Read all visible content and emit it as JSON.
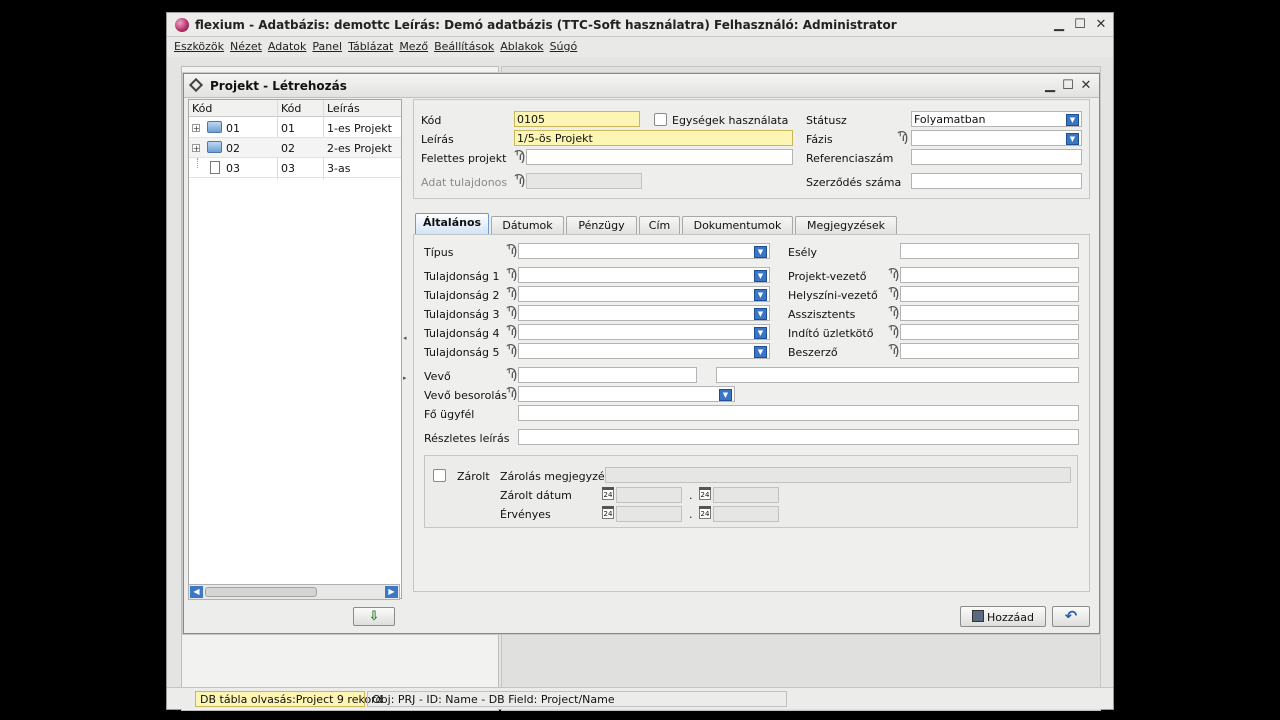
{
  "app": {
    "title": "flexium - Adatbázis: demottc  Leírás: Demó adatbázis (TTC-Soft használatra)  Felhasználó: Administrator",
    "window_buttons": {
      "minimize": "▁",
      "maximize": "☐",
      "close": "✕"
    }
  },
  "menu": [
    "Eszközök",
    "Nézet",
    "Adatok",
    "Panel",
    "Táblázat",
    "Mező",
    "Beállítások",
    "Ablakok",
    "Súgó"
  ],
  "dialog": {
    "title": "Projekt - Létrehozás",
    "window_buttons": {
      "minimize": "▁",
      "maximize": "☐",
      "close": "✕"
    }
  },
  "tree": {
    "columns": [
      "Kód",
      "Kód",
      "Leírás"
    ],
    "rows": [
      {
        "expander": "+",
        "icon": "folder-icon",
        "code1": "01",
        "code2": "01",
        "desc": "1-es Projekt"
      },
      {
        "expander": "+",
        "icon": "folder-icon",
        "code1": "02",
        "code2": "02",
        "desc": "2-es Projekt"
      },
      {
        "expander": "",
        "icon": "document-icon",
        "code1": "03",
        "code2": "03",
        "desc": "3-as"
      }
    ],
    "scroll_left": "◀",
    "scroll_right": "▶"
  },
  "header_form": {
    "kod_label": "Kód",
    "kod_value": "0105",
    "leiras_label": "Leírás",
    "leiras_value": "1/5-ös Projekt",
    "felettes_label": "Felettes projekt",
    "felettes_value": "",
    "adat_tulajdonos_label": "Adat tulajdonos",
    "egysegek_label": "Egységek használata",
    "statusz_label": "Státusz",
    "statusz_value": "Folyamatban",
    "fazis_label": "Fázis",
    "fazis_value": "",
    "referenciaszam_label": "Referenciaszám",
    "szerzodes_label": "Szerződés száma"
  },
  "tabs": [
    "Általános",
    "Dátumok",
    "Pénzügy",
    "Cím",
    "Dokumentumok",
    "Megjegyzések"
  ],
  "general_tab": {
    "tipus_label": "Típus",
    "tulajdonsag_labels": [
      "Tulajdonság 1",
      "Tulajdonság 2",
      "Tulajdonság 3",
      "Tulajdonság 4",
      "Tulajdonság 5"
    ],
    "esely_label": "Esély",
    "right_labels": [
      "Projekt-vezető",
      "Helyszíni-vezető",
      "Asszisztents",
      "Indító üzletkötő",
      "Beszerző"
    ],
    "vevo_label": "Vevő",
    "vevo_besorolas_label": "Vevő besorolás",
    "fo_ugyfel_label": "Fő ügyfél",
    "reszletes_leiras_label": "Részletes leírás",
    "zarolt_label": "Zárolt",
    "zarolas_megjegyzes_label": "Zárolás megjegyzés",
    "zarolt_datum_label": "Zárolt dátum",
    "ervenyes_label": "Érvényes",
    "calendar_day": "24",
    "date_separator": "."
  },
  "buttons": {
    "hozzaad": "Hozzáad",
    "undo_icon": "↶",
    "export_icon": "⇩"
  },
  "lookup_glyph": "Ϡ",
  "dropdown_glyph": "▼",
  "status": {
    "left": "DB tábla olvasás:Project 9 rekord",
    "right": "Obj: PRJ - ID: Name - DB Field: Project/Name"
  }
}
